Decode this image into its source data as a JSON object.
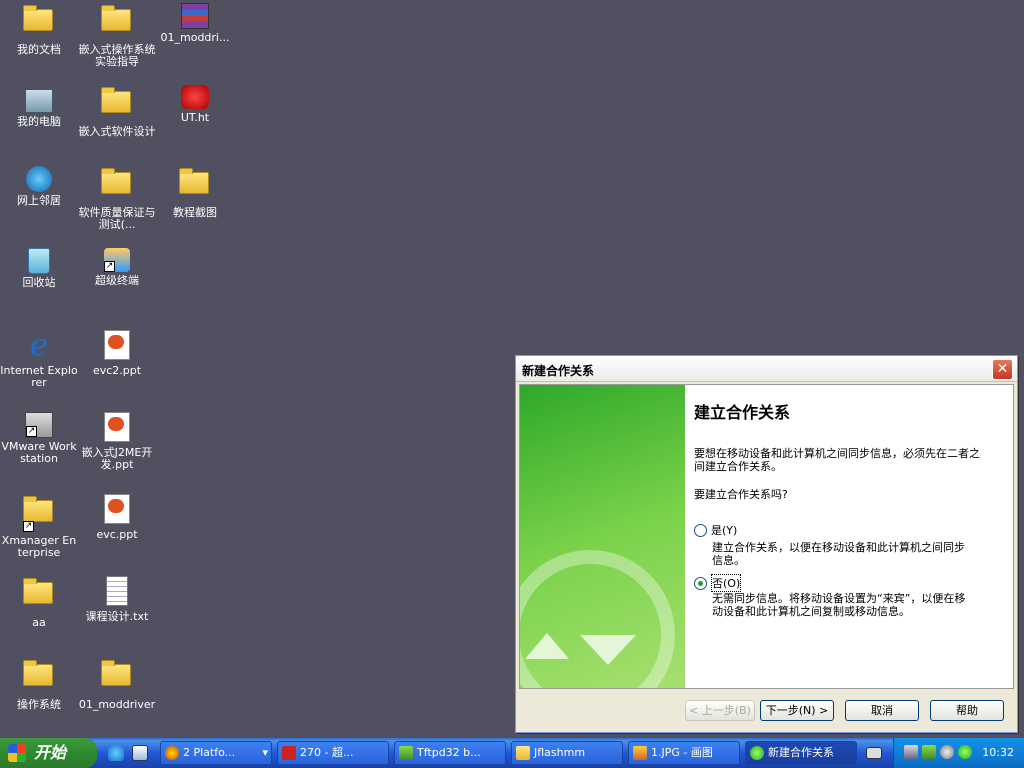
{
  "desktop": {
    "icons": [
      {
        "label": "我的文档",
        "icon": "my-documents-icon"
      },
      {
        "label": "嵌入式操作系统实验指导",
        "icon": "folder-icon"
      },
      {
        "label": "01_moddri...",
        "icon": "winrar-archive-icon"
      },
      {
        "label": "我的电脑",
        "icon": "my-computer-icon"
      },
      {
        "label": "嵌入式软件设计",
        "icon": "folder-icon"
      },
      {
        "label": "UT.ht",
        "icon": "hyperterminal-icon"
      },
      {
        "label": "网上邻居",
        "icon": "network-places-icon"
      },
      {
        "label": "软件质量保证与测试(...",
        "icon": "folder-icon"
      },
      {
        "label": "教程截图",
        "icon": "folder-icon"
      },
      {
        "label": "回收站",
        "icon": "recycle-bin-icon"
      },
      {
        "label": "超级终端",
        "icon": "hyperterminal-shortcut-icon"
      },
      {
        "label": "Internet Explorer",
        "icon": "internet-explorer-icon"
      },
      {
        "label": "evc2.ppt",
        "icon": "ppt-file-icon"
      },
      {
        "label": "VMware Workstation",
        "icon": "vmware-icon"
      },
      {
        "label": "嵌入式J2ME开发.ppt",
        "icon": "ppt-file-icon"
      },
      {
        "label": "Xmanager Enterprise",
        "icon": "xmanager-icon"
      },
      {
        "label": "evc.ppt",
        "icon": "ppt-file-icon"
      },
      {
        "label": "aa",
        "icon": "folder-icon"
      },
      {
        "label": "课程设计.txt",
        "icon": "text-file-icon"
      },
      {
        "label": "操作系统",
        "icon": "folder-icon"
      },
      {
        "label": "01_moddriver",
        "icon": "folder-icon"
      }
    ]
  },
  "dialog": {
    "title": "新建合作关系",
    "heading": "建立合作关系",
    "intro": "要想在移动设备和此计算机之间同步信息，必须先在二者之间建立合作关系。",
    "question": "要建立合作关系吗?",
    "option_yes": {
      "label": "是(Y)",
      "desc": "建立合作关系，以便在移动设备和此计算机之间同步信息。",
      "checked": false
    },
    "option_no": {
      "label": "否(O)",
      "desc": "无需同步信息。将移动设备设置为“来宾”，以便在移动设备和此计算机之间复制或移动信息。",
      "checked": true
    },
    "buttons": {
      "back": "< 上一步(B)",
      "next": "下一步(N) >",
      "cancel": "取消",
      "help": "帮助"
    }
  },
  "taskbar": {
    "start_label": "开始",
    "tasks": [
      {
        "label": "2 Platfo...",
        "icon": "platform-builder-icon"
      },
      {
        "label": "270 - 超...",
        "icon": "hyperterminal-icon"
      },
      {
        "label": "Tftpd32 b...",
        "icon": "tftpd-icon"
      },
      {
        "label": "Jflashmm",
        "icon": "folder-icon"
      },
      {
        "label": "1.JPG - 画图",
        "icon": "paint-icon"
      },
      {
        "label": "新建合作关系",
        "icon": "activesync-icon"
      }
    ],
    "clock": "10:32"
  },
  "colors": {
    "desktop_bg": "#505060",
    "taskbar": "#245edb",
    "start": "#3c9a3c"
  }
}
